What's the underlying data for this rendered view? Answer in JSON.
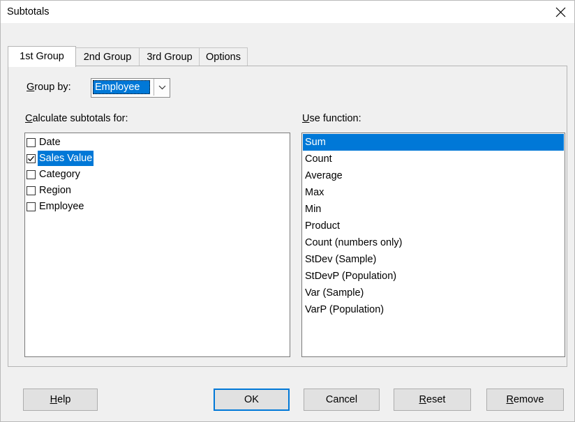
{
  "window": {
    "title": "Subtotals"
  },
  "tabs": [
    {
      "label": "1st Group",
      "active": true
    },
    {
      "label": "2nd Group",
      "active": false
    },
    {
      "label": "3rd Group",
      "active": false
    },
    {
      "label": "Options",
      "active": false
    }
  ],
  "group_by": {
    "label_mnemonic": "G",
    "label_rest": "roup by:",
    "value": "Employee"
  },
  "calculate": {
    "label_mnemonic": "C",
    "label_rest": "alculate subtotals for:",
    "items": [
      {
        "label": "Date",
        "checked": false,
        "selected": false
      },
      {
        "label": "Sales Value",
        "checked": true,
        "selected": true
      },
      {
        "label": "Category",
        "checked": false,
        "selected": false
      },
      {
        "label": "Region",
        "checked": false,
        "selected": false
      },
      {
        "label": "Employee",
        "checked": false,
        "selected": false
      }
    ]
  },
  "functions": {
    "label_mnemonic": "U",
    "label_rest": "se function:",
    "items": [
      {
        "label": "Sum",
        "selected": true
      },
      {
        "label": "Count",
        "selected": false
      },
      {
        "label": "Average",
        "selected": false
      },
      {
        "label": "Max",
        "selected": false
      },
      {
        "label": "Min",
        "selected": false
      },
      {
        "label": "Product",
        "selected": false
      },
      {
        "label": "Count (numbers only)",
        "selected": false
      },
      {
        "label": "StDev (Sample)",
        "selected": false
      },
      {
        "label": "StDevP (Population)",
        "selected": false
      },
      {
        "label": "Var (Sample)",
        "selected": false
      },
      {
        "label": "VarP (Population)",
        "selected": false
      }
    ]
  },
  "buttons": {
    "help": {
      "mnemonic": "H",
      "rest": "elp"
    },
    "ok": {
      "label": "OK"
    },
    "cancel": {
      "label": "Cancel"
    },
    "reset": {
      "mnemonic": "R",
      "rest": "eset"
    },
    "remove": {
      "mnemonic": "R",
      "rest": "emove"
    }
  },
  "colors": {
    "selection": "#0078d7",
    "dialog_bg": "#f0f0f0"
  }
}
